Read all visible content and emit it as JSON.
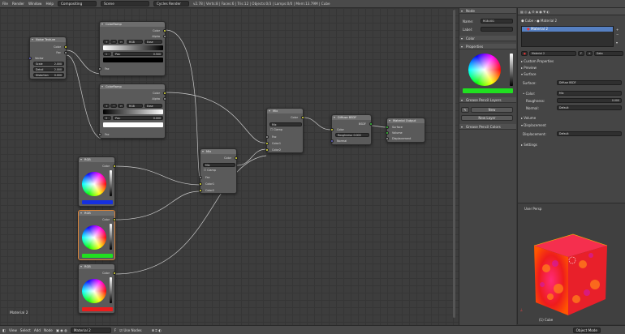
{
  "topbar": {
    "menus": [
      "File",
      "Render",
      "Window",
      "Help"
    ],
    "editor_type": "Compositing",
    "scene": "Scene",
    "engine": "Cycles Render",
    "stats": "v2.78 | Verts:8 | Faces:6 | Tris:12 | Objects:0/3 | Lamps:0/0 | Mem:13.79M | Cube"
  },
  "nodes": {
    "noise": {
      "title": "Noise Texture",
      "out_color": "Color",
      "out_fac": "Fac",
      "in_vector": "Vector",
      "scale_label": "Scale",
      "scale": "2.000",
      "detail_label": "Detail",
      "detail": "2.000",
      "distortion_label": "Distortion",
      "distortion": "0.000"
    },
    "ramp1": {
      "title": "ColorRamp",
      "out_color": "Color",
      "out_alpha": "Alpha",
      "mode": "RGB",
      "interp": "Ease",
      "pos_label": "Pos:",
      "pos": "0.500",
      "stop_index": "1",
      "in_fac": "Fac"
    },
    "ramp2": {
      "title": "ColorRamp",
      "out_color": "Color",
      "out_alpha": "Alpha",
      "mode": "RGB",
      "interp": "Ease",
      "pos_label": "Pos:",
      "pos": "0.000",
      "stop_index": "0",
      "in_fac": "Fac"
    },
    "rgb1": {
      "title": "RGB",
      "out_color": "Color"
    },
    "rgb2": {
      "title": "RGB",
      "out_color": "Color"
    },
    "rgb3": {
      "title": "RGB",
      "out_color": "Color"
    },
    "mix1": {
      "title": "Mix",
      "out_color": "Color",
      "blend": "Mix",
      "clamp": "Clamp",
      "in_fac": "Fac",
      "in_color1": "Color1",
      "in_color2": "Color2"
    },
    "mix2": {
      "title": "Mix",
      "out_color": "Color",
      "blend": "Mix",
      "clamp": "Clamp",
      "in_fac": "Fac",
      "in_color1": "Color1",
      "in_color2": "Color2"
    },
    "diffuse": {
      "title": "Diffuse BSDF",
      "out_bsdf": "BSDF",
      "in_color": "Color",
      "in_roughness": "Roughness: 0.000",
      "in_normal": "Normal"
    },
    "output": {
      "title": "Material Output",
      "in_surface": "Surface",
      "in_volume": "Volume",
      "in_displacement": "Displacement"
    }
  },
  "editor_label": "Material 2",
  "sidepanel": {
    "node_header": "Node",
    "name_label": "Name:",
    "name_value": "RGB.001",
    "label_label": "Label:",
    "color_header": "Color",
    "properties_header": "Properties",
    "gp_layers_header": "Grease Pencil Layers",
    "new_btn": "New",
    "new_layer_btn": "New Layer",
    "gp_colors_header": "Grease Pencil Colors"
  },
  "props": {
    "breadcrumb_obj": "Cube",
    "breadcrumb_mat": "Material 2",
    "slot": "Material 2",
    "material_field": "Material 2",
    "data_field": "Data",
    "custom_props": "Custom Properties",
    "preview": "Preview",
    "surface_header": "Surface",
    "surface_label": "Surface:",
    "surface_value": "Diffuse BSDF",
    "color_label": "Color:",
    "color_value": "Mix",
    "roughness_label": "Roughness:",
    "roughness_value": "0.000",
    "normal_label": "Normal:",
    "normal_value": "Default",
    "volume": "Volume",
    "displacement_header": "Displacement",
    "displacement_label": "Displacement:",
    "displacement_value": "Default",
    "settings": "Settings"
  },
  "viewport": {
    "title": "User Persp",
    "object_label": "(1) Cube"
  },
  "bottombar": {
    "items": [
      "View",
      "Select",
      "Add",
      "Node"
    ],
    "material": "Material 2",
    "use_nodes": "Use Nodes",
    "mode": "Object Mode"
  },
  "colors": {
    "rgb1": "#1530e0",
    "rgb2": "#20e020",
    "rgb3": "#ee1c1c",
    "selection": "#5680c2"
  }
}
